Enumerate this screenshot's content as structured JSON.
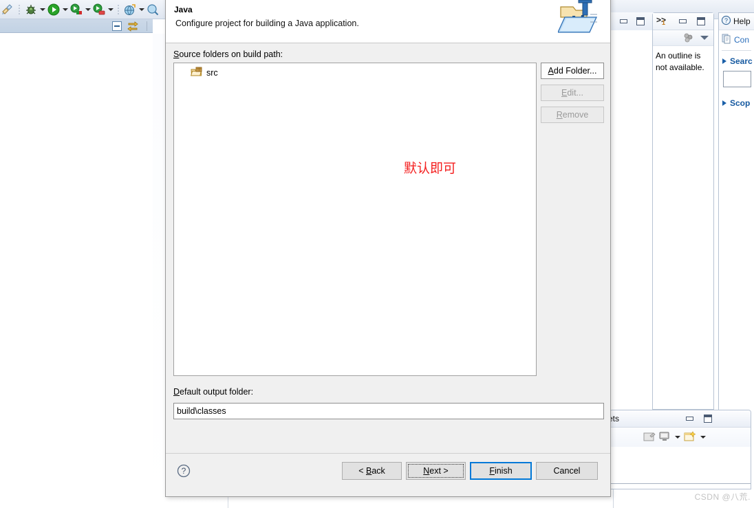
{
  "workbench": {
    "toolbar_icons": [
      "debug-icon",
      "run-icon",
      "coverage-icon",
      "profile-icon",
      "external-tools-icon",
      "search-icon"
    ],
    "subtoolbar_icons": [
      "collapse-all-icon",
      "link-with-editor-icon"
    ]
  },
  "outline_view": {
    "overflow_label": ">>",
    "overflow_count": "1",
    "message": "An outline is not available."
  },
  "help_view": {
    "tab_label": "Help",
    "content_link": "Con",
    "search_section": "Searc",
    "scope_section": "Scop",
    "search_value": ""
  },
  "snippets_view": {
    "tab_label": "ets"
  },
  "watermark": "CSDN @八荒.",
  "dialog": {
    "title": "Java",
    "subtitle": "Configure project for building a Java application.",
    "banner_icon": "java-project-folder-icon",
    "source_label_mnemonic": "S",
    "source_label_rest": "ource folders on build path:",
    "source_items": [
      {
        "label": "src",
        "icon": "source-folder-icon"
      }
    ],
    "annotation": "默认即可",
    "buttons_side": [
      {
        "name": "add-folder-button",
        "mnemonic": "A",
        "pre": "",
        "rest": "dd Folder...",
        "enabled": true
      },
      {
        "name": "edit-button",
        "mnemonic": "E",
        "pre": "",
        "rest": "dit...",
        "enabled": false
      },
      {
        "name": "remove-button",
        "mnemonic": "R",
        "pre": "",
        "rest": "emove",
        "enabled": false
      }
    ],
    "output_label_mnemonic": "D",
    "output_label_rest": "efault output folder:",
    "output_value": "build\\classes",
    "output_placeholder": "",
    "help_button": "?",
    "buttons_footer": [
      {
        "name": "back-button",
        "pre": "< ",
        "mnemonic": "B",
        "rest": "ack",
        "style": "normal"
      },
      {
        "name": "next-button",
        "pre": "",
        "mnemonic": "N",
        "rest": "ext >",
        "style": "focused"
      },
      {
        "name": "finish-button",
        "pre": "",
        "mnemonic": "F",
        "rest": "inish",
        "style": "default"
      },
      {
        "name": "cancel-button",
        "pre": "",
        "mnemonic": "",
        "rest": "Cancel",
        "style": "normal"
      }
    ]
  },
  "colors": {
    "accent_blue": "#0078d7",
    "annotation_red": "#f42020",
    "link_blue": "#1559a0",
    "dialog_bg": "#f0f0f0"
  }
}
